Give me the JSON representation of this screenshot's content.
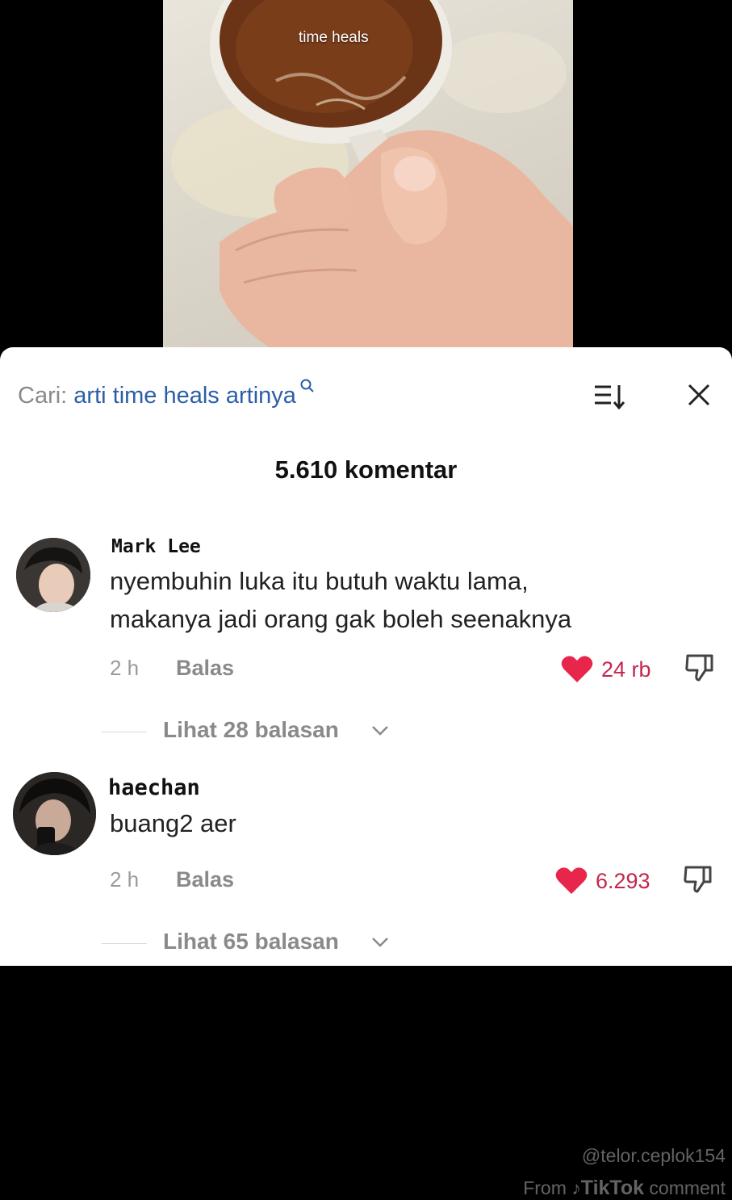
{
  "video": {
    "caption": "time heals"
  },
  "search": {
    "prefix": "Cari:",
    "term": "arti time heals artinya"
  },
  "icons": {
    "search": "search-icon",
    "sort": "sort-icon",
    "close": "close-icon",
    "heart": "heart-icon",
    "dislike": "thumbs-down-icon",
    "chevron": "chevron-down-icon"
  },
  "comment_count": "5.610 komentar",
  "comments": [
    {
      "username": "Mark Lee",
      "text_line1": "nyembuhin luka itu butuh waktu lama,",
      "text_line2": "makanya jadi orang gak boleh seenaknya",
      "time": "2 h",
      "reply_label": "Balas",
      "likes": "24 rb",
      "view_replies": "Lihat 28 balasan"
    },
    {
      "username": "haechan",
      "text_line1": "buang2 aer",
      "time": "2 h",
      "reply_label": "Balas",
      "likes": "6.293",
      "view_replies": "Lihat 65 balasan"
    }
  ],
  "watermark": {
    "handle": "@telor.ceplok154",
    "from": "From",
    "brand": "TikTok",
    "suffix": "comment"
  },
  "colors": {
    "search_term": "#2c5ea8",
    "like": "#e8264c"
  }
}
